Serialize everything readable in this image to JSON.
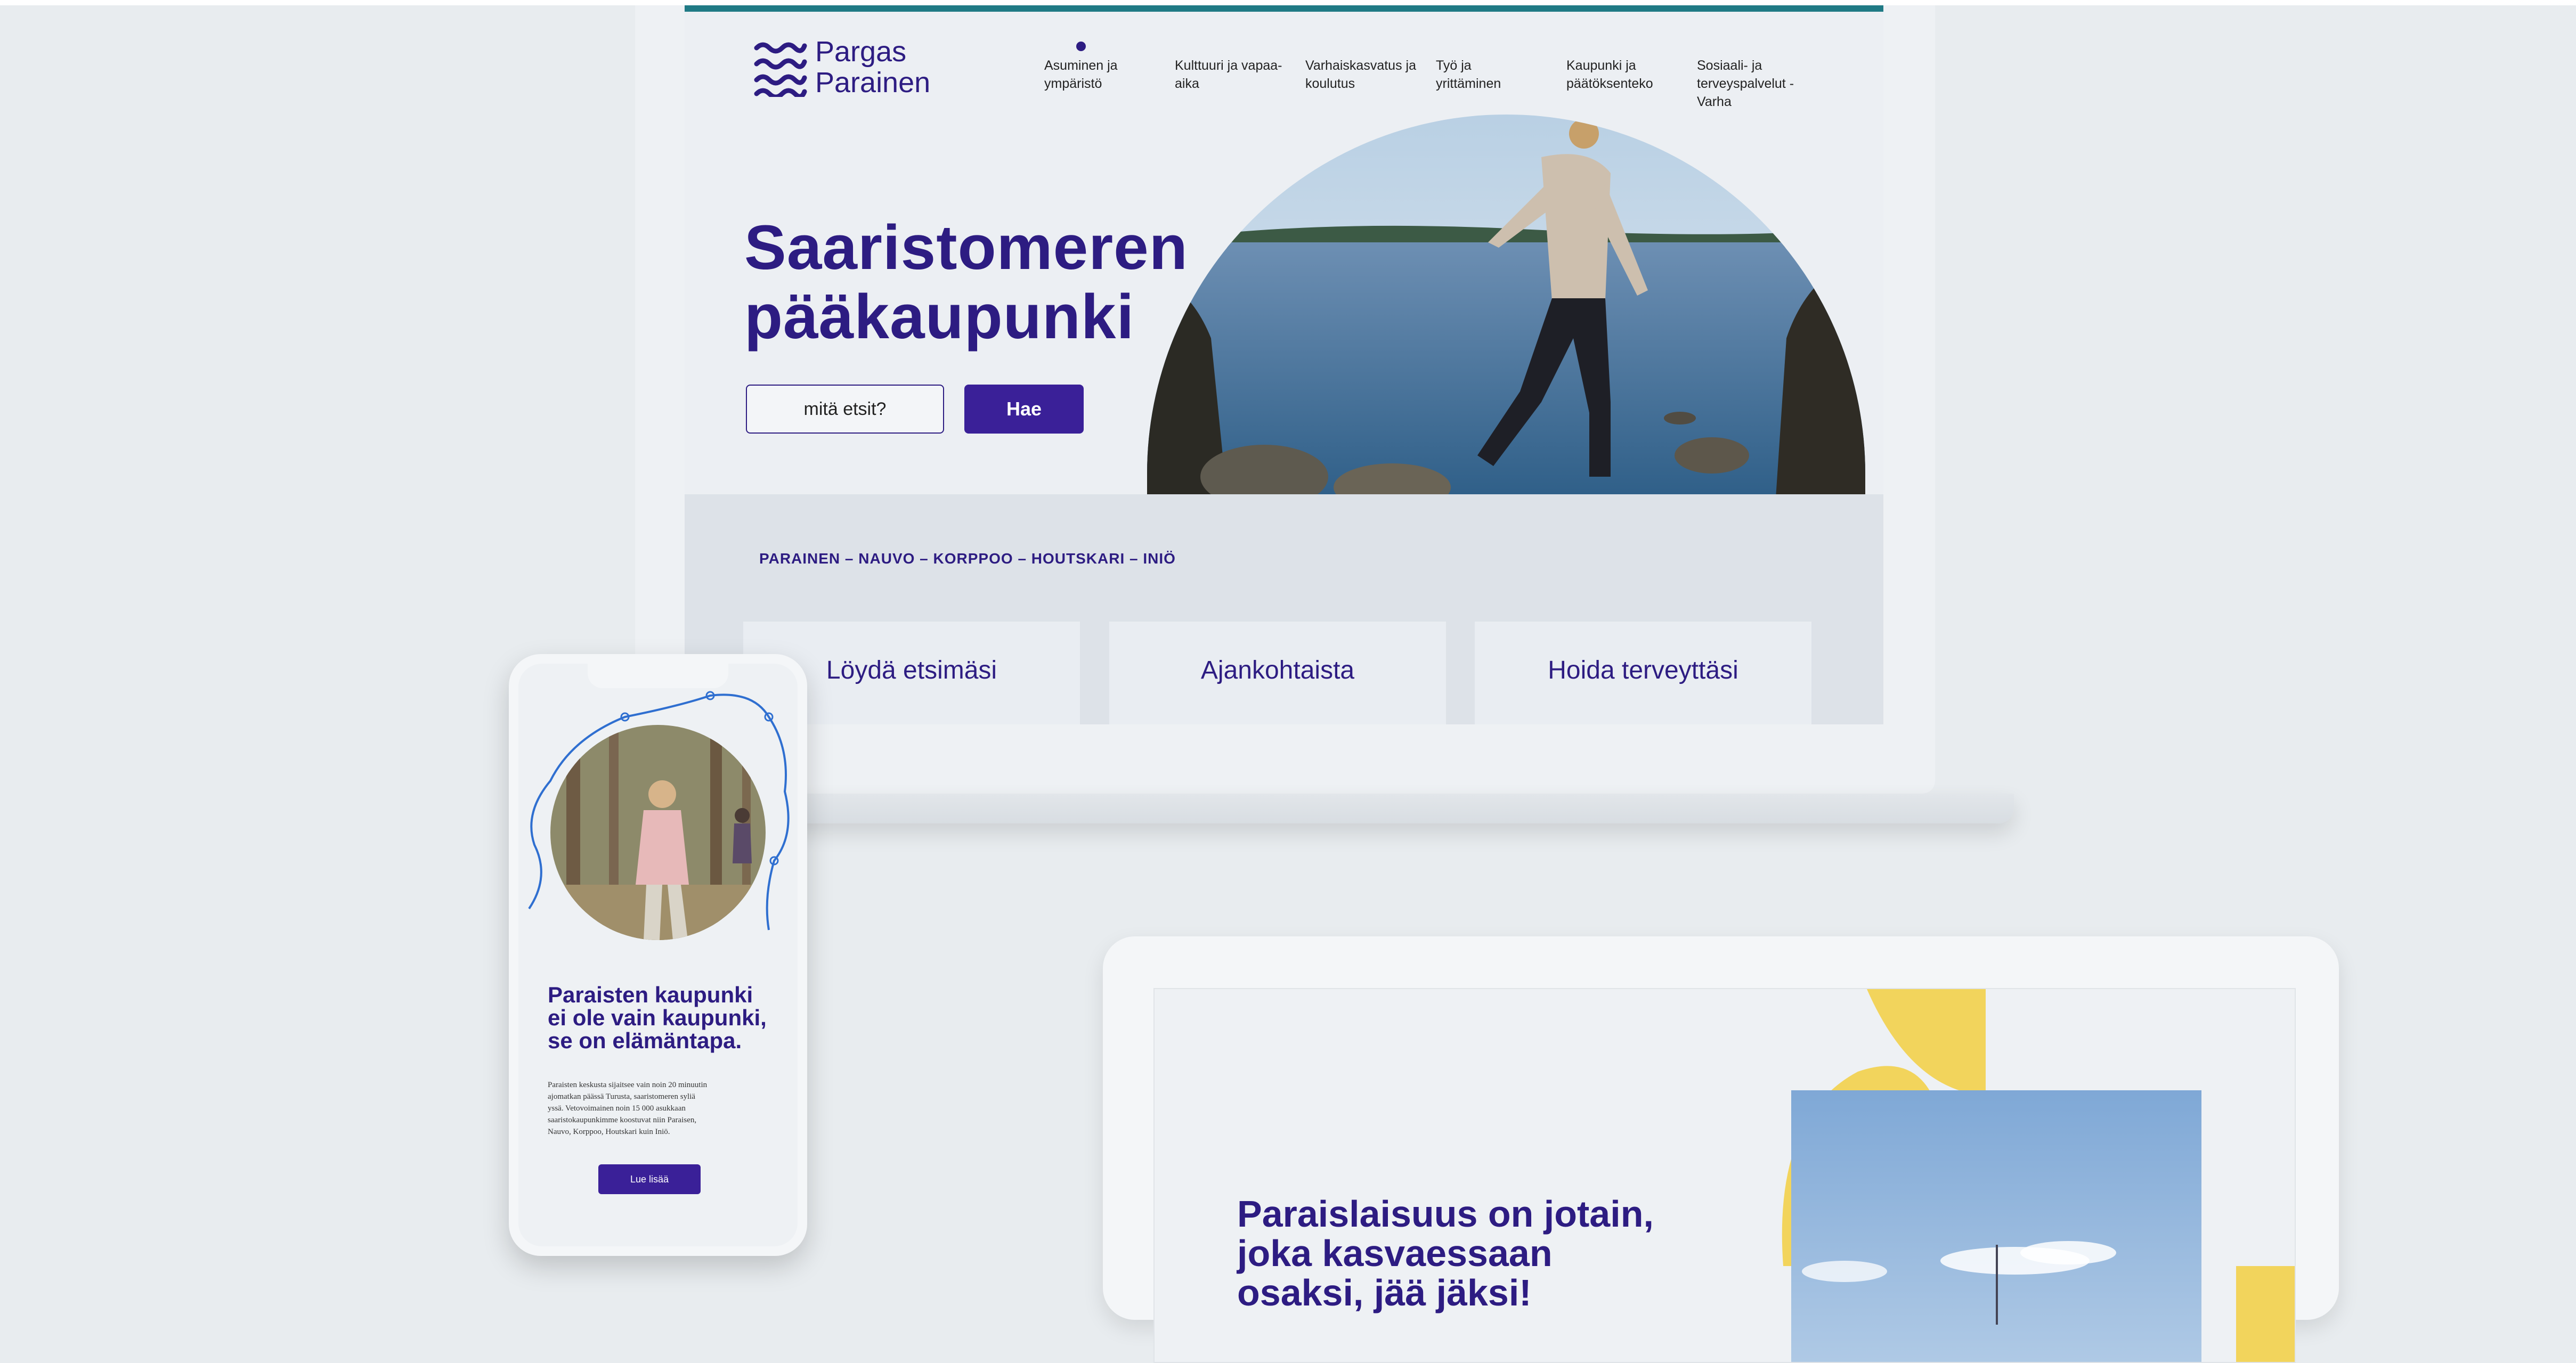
{
  "site": {
    "logo_line1": "Pargas",
    "logo_line2": "Parainen",
    "nav": [
      {
        "line1": "Asuminen ja",
        "line2": "ympäristö",
        "line3": ""
      },
      {
        "line1": "Kulttuuri ja vapaa-",
        "line2": "aika",
        "line3": ""
      },
      {
        "line1": "Varhaiskasvatus ja",
        "line2": "koulutus",
        "line3": ""
      },
      {
        "line1": "Työ ja",
        "line2": "yrittäminen",
        "line3": ""
      },
      {
        "line1": "Kaupunki ja",
        "line2": "päätöksenteko",
        "line3": ""
      },
      {
        "line1": "Sosiaali- ja",
        "line2": "terveyspalvelut -",
        "line3": "Varha"
      }
    ],
    "hero_title_line1": "Saaristomeren",
    "hero_title_line2": "pääkaupunki",
    "search_placeholder": "mitä etsit?",
    "search_button": "Hae",
    "islands": "PARAINEN – NAUVO – KORPPOO – HOUTSKARI – INIÖ",
    "cards": [
      "Löydä etsimäsi",
      "Ajankohtaista",
      "Hoida terveyttäsi"
    ]
  },
  "phone": {
    "title_line1": "Paraisten kaupunki",
    "title_line2": "ei ole vain kaupunki,",
    "title_line3": "se on elämäntapa.",
    "body_lines": [
      "Paraisten keskusta sijaitsee vain noin 20 minuutin",
      "ajomatkan päässä Turusta, saaristomeren syliä",
      "yssä. Vetovoimainen noin 15 000 asukkaan",
      "saaristokaupunkimme koostuvat niin Paraisen,",
      "Nauvo, Korppoo, Houtskari kuin Iniö."
    ],
    "button": "Lue lisää"
  },
  "tablet": {
    "title_line1": "Paraislaisuus on jotain,",
    "title_line2": "joka kasvaessaan",
    "title_line3": "osaksi, jää jäksi!"
  },
  "colors": {
    "brand_purple": "#2d1c82",
    "button_purple": "#3a2098",
    "teal_bar": "#1f7a85",
    "accent_yellow": "#f2d45c"
  }
}
